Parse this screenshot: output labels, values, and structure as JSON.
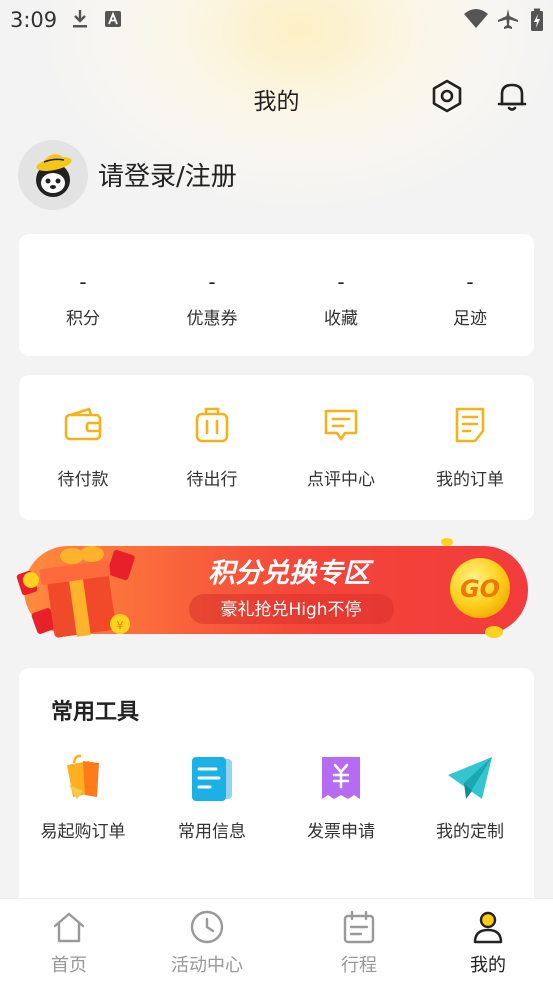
{
  "status_bar": {
    "time": "3:09"
  },
  "header": {
    "title": "我的"
  },
  "profile": {
    "login_label": "请登录/注册"
  },
  "stats": [
    {
      "value": "-",
      "label": "积分"
    },
    {
      "value": "-",
      "label": "优惠券"
    },
    {
      "value": "-",
      "label": "收藏"
    },
    {
      "value": "-",
      "label": "足迹"
    }
  ],
  "orders": [
    {
      "label": "待付款",
      "icon": "wallet-icon"
    },
    {
      "label": "待出行",
      "icon": "luggage-icon"
    },
    {
      "label": "点评中心",
      "icon": "review-icon"
    },
    {
      "label": "我的订单",
      "icon": "order-list-icon"
    }
  ],
  "banner": {
    "title": "积分兑换专区",
    "subtitle": "豪礼抢兑High不停",
    "go_label": "GO"
  },
  "tools": {
    "title": "常用工具",
    "items": [
      {
        "label": "易起购订单",
        "icon": "shopping-bag-icon"
      },
      {
        "label": "常用信息",
        "icon": "document-icon"
      },
      {
        "label": "发票申请",
        "icon": "invoice-icon"
      },
      {
        "label": "我的定制",
        "icon": "paper-plane-icon"
      }
    ]
  },
  "tabs": [
    {
      "label": "首页",
      "icon": "home-icon",
      "active": false
    },
    {
      "label": "活动中心",
      "icon": "clock-icon",
      "active": false
    },
    {
      "label": "行程",
      "icon": "calendar-icon",
      "active": false
    },
    {
      "label": "我的",
      "icon": "user-icon",
      "active": true
    }
  ],
  "colors": {
    "accent": "#f7b21b",
    "banner_red": "#f4463a",
    "active_tab": "#222222",
    "inactive_tab": "#999999"
  }
}
